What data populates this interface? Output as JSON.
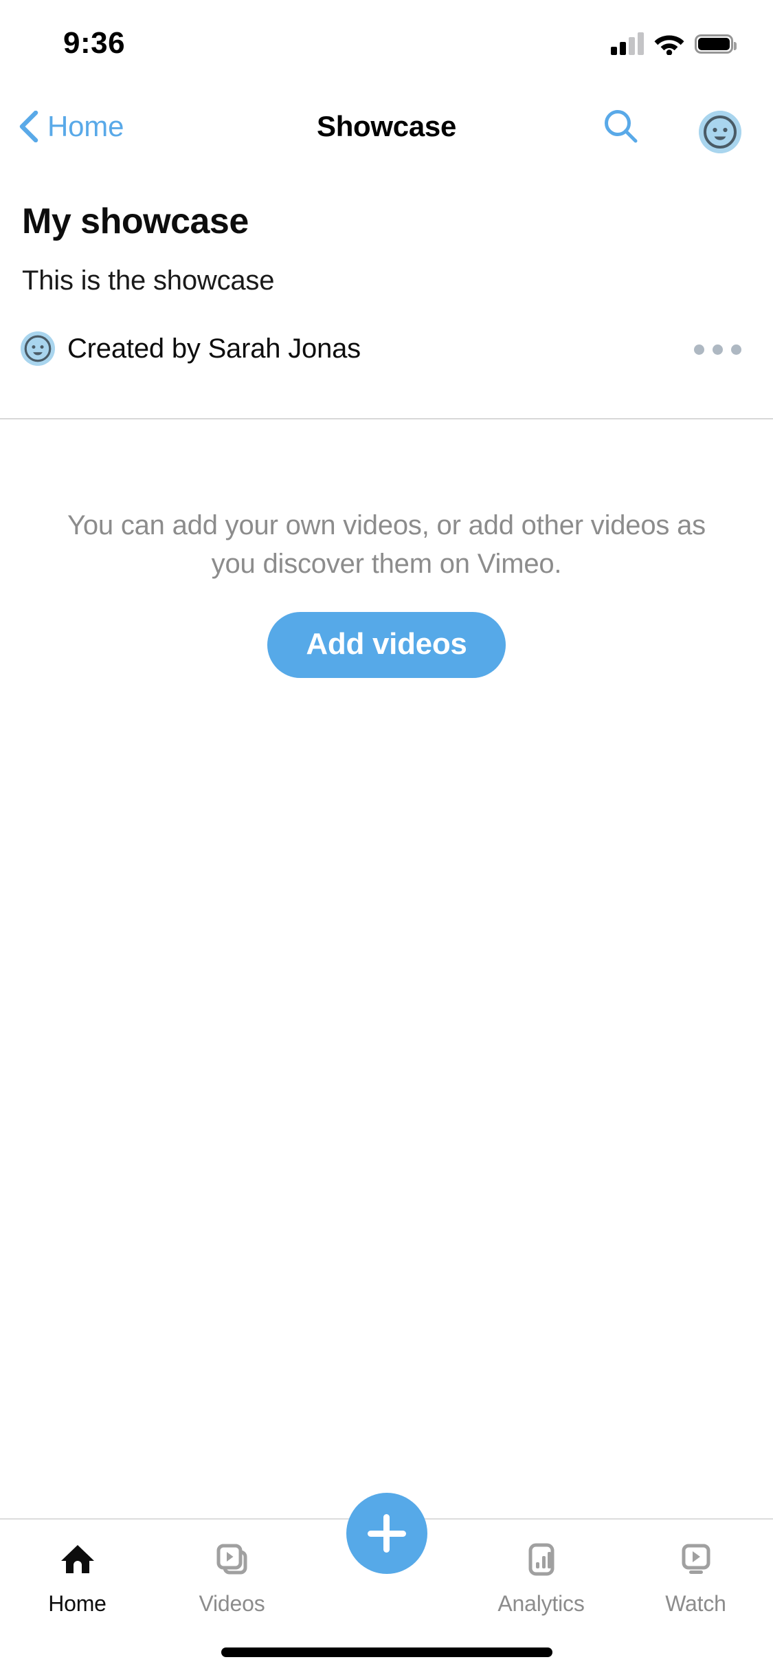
{
  "status_bar": {
    "time": "9:36",
    "cellular_icon": "cellular-signal-icon",
    "cellular_bars_filled": 2,
    "cellular_bars_total": 4,
    "wifi_icon": "wifi-icon",
    "battery_icon": "battery-icon",
    "battery_level_percent": 100
  },
  "nav_bar": {
    "back_label": "Home",
    "back_icon": "chevron-left-icon",
    "title": "Showcase",
    "search_icon": "search-icon",
    "avatar_icon": "user-avatar-icon",
    "accent_color": "#59a9e8"
  },
  "showcase": {
    "title": "My showcase",
    "description": "This is the showcase",
    "creator_label": "Created by Sarah Jonas",
    "creator_avatar_icon": "user-avatar-icon",
    "more_icon": "more-horizontal-icon"
  },
  "empty_state": {
    "message": "You can add your own videos, or add other videos as you discover them on Vimeo.",
    "button_label": "Add videos",
    "button_color": "#56a9e8",
    "text_color": "#8c8c8c"
  },
  "tab_bar": {
    "items": [
      {
        "label": "Home",
        "icon": "home-icon",
        "active": true
      },
      {
        "label": "Videos",
        "icon": "videos-icon",
        "active": false
      },
      {
        "label": "Analytics",
        "icon": "analytics-icon",
        "active": false
      },
      {
        "label": "Watch",
        "icon": "watch-icon",
        "active": false
      }
    ],
    "fab": {
      "icon": "plus-icon",
      "color": "#56a9e8"
    },
    "active_color": "#0d0d0d",
    "inactive_color": "#8c8c8c"
  },
  "home_indicator": {
    "present": true
  }
}
